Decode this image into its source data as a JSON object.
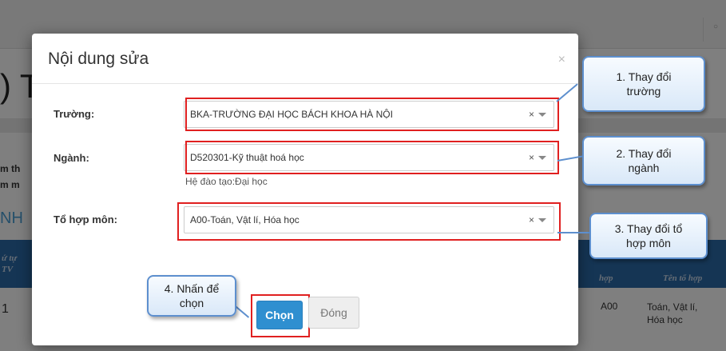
{
  "background": {
    "title_fragment": ") TI",
    "left_texts": [
      "m th",
      "m m"
    ],
    "nh_text": "NH",
    "table_headers": [
      "ứ tự\nTV",
      "hợp",
      "Tên tổ hợp"
    ],
    "row": {
      "index": "1",
      "code": "A00",
      "name": "Toán, Vật lí,\nHóa học"
    }
  },
  "modal": {
    "title": "Nội dung sửa",
    "close_symbol": "×",
    "fields": [
      {
        "label": "Trường:",
        "value": "BKA-TRƯỜNG ĐẠI HỌC BÁCH KHOA HÀ NỘI",
        "clear": "×"
      },
      {
        "label": "Ngành:",
        "value": "D520301-Kỹ thuật hoá học",
        "clear": "×",
        "help": "Hệ đào tạo:Đại học"
      },
      {
        "label": "Tổ hợp môn:",
        "value": "A00-Toán, Vật lí, Hóa học",
        "clear": "×"
      }
    ],
    "buttons": {
      "primary": "Chọn",
      "secondary": "Đóng"
    }
  },
  "callouts": [
    {
      "text": "1. Thay đổi\ntrường"
    },
    {
      "text": "2. Thay đổi\nngành"
    },
    {
      "text": "3. Thay đổi tổ\nhợp môn"
    },
    {
      "text": "4. Nhấn để\nchọn"
    }
  ]
}
